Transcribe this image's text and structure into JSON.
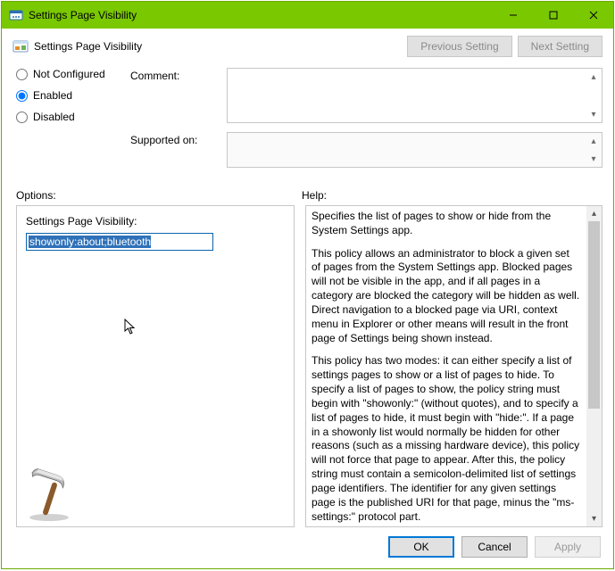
{
  "window": {
    "title": "Settings Page Visibility"
  },
  "header": {
    "title": "Settings Page Visibility",
    "prev": "Previous Setting",
    "next": "Next Setting"
  },
  "state": {
    "not_configured": "Not Configured",
    "enabled": "Enabled",
    "disabled": "Disabled",
    "selected": "enabled"
  },
  "form": {
    "comment_label": "Comment:",
    "comment_value": "",
    "supported_label": "Supported on:",
    "supported_value": ""
  },
  "section_labels": {
    "options": "Options:",
    "help": "Help:"
  },
  "options": {
    "field_label": "Settings Page Visibility:",
    "field_value": "showonly:about;bluetooth"
  },
  "help": {
    "p1": "Specifies the list of pages to show or hide from the System Settings app.",
    "p2": "This policy allows an administrator to block a given set of pages from the System Settings app. Blocked pages will not be visible in the app, and if all pages in a category are blocked the category will be hidden as well. Direct navigation to a blocked page via URI, context menu in Explorer or other means will result in the front page of Settings being shown instead.",
    "p3": "This policy has two modes: it can either specify a list of settings pages to show or a list of pages to hide. To specify a list of pages to show, the policy string must begin with \"showonly:\" (without quotes), and to specify a list of pages to hide, it must begin with \"hide:\". If a page in a showonly list would normally be hidden for other reasons (such as a missing hardware device), this policy will not force that page to appear. After this, the policy string must contain a semicolon-delimited list of settings page identifiers. The identifier for any given settings page is the published URI for that page, minus the \"ms-settings:\" protocol part."
  },
  "footer": {
    "ok": "OK",
    "cancel": "Cancel",
    "apply": "Apply"
  }
}
